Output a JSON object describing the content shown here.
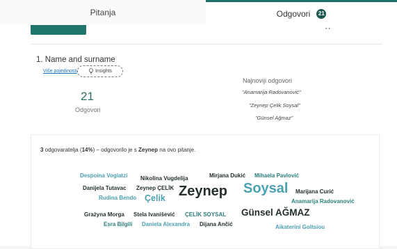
{
  "tabs": {
    "questions_label": "Pitanja",
    "answers_label": "Odgovori",
    "answers_badge": "21"
  },
  "question": {
    "title": "1. Name and surname",
    "more_details": "Više pojedinosti",
    "insights_label": "Insights",
    "count": "21",
    "count_label": "Odgovori",
    "latest_title": "Najnoviji odgovori",
    "latest": [
      "\"Anamarija Radovanović\"",
      "\"Zeynep Çelik Soysal\"",
      "\"Günsel Ağmaz\""
    ]
  },
  "wordcloud": {
    "summary": {
      "count": "3",
      "text1": " odgovaratelja (",
      "percent": "14%",
      "text2": ") – odgovorilo je s ",
      "keyword": "Zeynep",
      "text3": " na ovo pitanje."
    },
    "words": [
      "Despoina Vogiatzi",
      "Nikolina Vugdelija",
      "Mirjana Dukić",
      "Mihaela Pavlović",
      "Danijela Tutavac",
      "Zeynep ÇELİK",
      "Zeynep",
      "Soysal",
      "Marijana Curić",
      "Rudina Bendo",
      "Çelik",
      "Anamarija Radovanović",
      "Grażyna Morga",
      "Stela Ivanišević",
      "ÇELİK SOYSAL",
      "Günsel AĞMAZ",
      "Esra Bilgili",
      "Daniela Alexandra",
      "Dijana Ančić",
      "Aikaterini Goltsiou"
    ]
  },
  "colors": {
    "accent": "#1f6f66",
    "badge": "#1f5a52",
    "word_dark": "#23302e",
    "word_teal": "#2a7f7a",
    "word_light": "#4ba0b2",
    "link": "#1a73b9"
  },
  "icons": [
    "lightbulb-icon"
  ]
}
